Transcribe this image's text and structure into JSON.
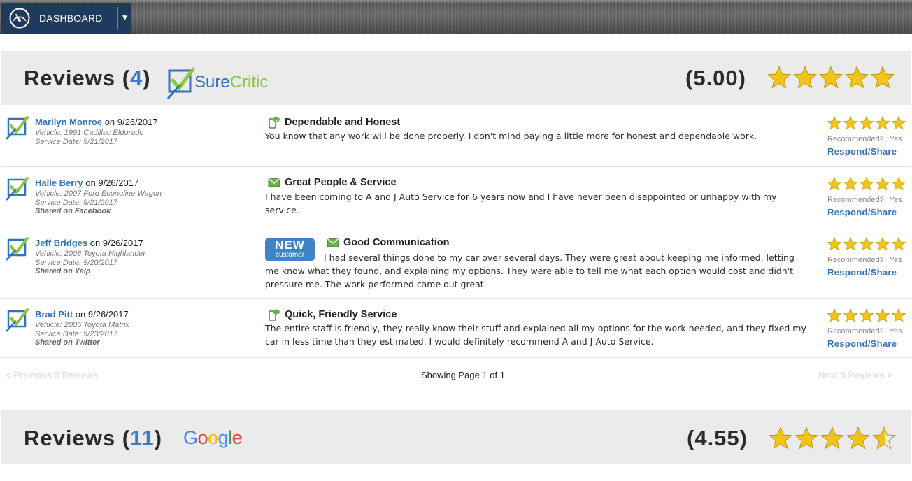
{
  "nav": {
    "dashboard_label": "DASHBOARD"
  },
  "colors": {
    "accent": "#3272b8",
    "star": "#f0c419",
    "header_bg": "#ebebeb",
    "nav_bg": "#1f3a5c"
  },
  "surecritic": {
    "title_prefix": "Reviews (",
    "count": "4",
    "title_suffix": ")",
    "brand_a": "Sure",
    "brand_b": "Critic",
    "score": "(5.00)",
    "rating": 5
  },
  "reviews": [
    {
      "author": "Marilyn Monroe",
      "on_date": "on 9/26/2017",
      "vehicle": "Vehicle: 1991 Cadillac Eldorado",
      "service": "Service Date: 9/21/2017",
      "shared": "",
      "title": "Dependable and Honest",
      "title_icon": "phone-chat-icon",
      "body": "You know that any work will be done properly. I don't mind paying a little more for honest and dependable work.",
      "rating": 5,
      "rec_label": "Recommended?",
      "rec_value": "Yes",
      "respond": "Respond/Share"
    },
    {
      "author": "Halle Berry",
      "on_date": "on 9/26/2017",
      "vehicle": "Vehicle: 2007 Ford Econoline Wagon",
      "service": "Service Date: 9/21/2017",
      "shared": "Shared on Facebook",
      "title": "Great People & Service",
      "title_icon": "envelope-icon",
      "body": "I have been coming to A and J Auto Service for 6 years now and I have never been disappointed or unhappy with my service.",
      "rating": 5,
      "rec_label": "Recommended?",
      "rec_value": "Yes",
      "respond": "Respond/Share"
    },
    {
      "author": "Jeff Bridges",
      "on_date": "on 9/26/2017",
      "vehicle": "Vehicle: 2008 Toyota Highlander",
      "service": "Service Date: 9/20/2017",
      "shared": "Shared on Yelp",
      "title": "Good Communication",
      "title_icon": "envelope-icon",
      "badge_top": "NEW",
      "badge_bottom": "customer",
      "body": "I had several things done to my car over several days. They were great about keeping me informed, letting me know what they found, and explaining my options. They were able to tell me what each option would cost and didn't pressure me. The work performed came out great.",
      "rating": 5,
      "rec_label": "Recommended?",
      "rec_value": "Yes",
      "respond": "Respond/Share"
    },
    {
      "author": "Brad Pitt",
      "on_date": "on 9/26/2017",
      "vehicle": "Vehicle: 2005 Toyota Matrix",
      "service": "Service Date: 9/23/2017",
      "shared": "Shared on Twitter",
      "title": "Quick, Friendly Service",
      "title_icon": "phone-chat-icon",
      "body": "The entire staff is friendly, they really know their stuff and explained all my options for the work needed, and they fixed my car in less time than they estimated. I would definitely recommend A and J Auto Service.",
      "rating": 5,
      "rec_label": "Recommended?",
      "rec_value": "Yes",
      "respond": "Respond/Share"
    }
  ],
  "pager": {
    "prev": "< Previous 5 Reviews",
    "page": "Showing Page 1 of 1",
    "next": "Next 5 Reviews >"
  },
  "google": {
    "title_prefix": "Reviews (",
    "count": "11",
    "title_suffix": ")",
    "brand": "Google",
    "score": "(4.55)",
    "rating": 4.55
  }
}
